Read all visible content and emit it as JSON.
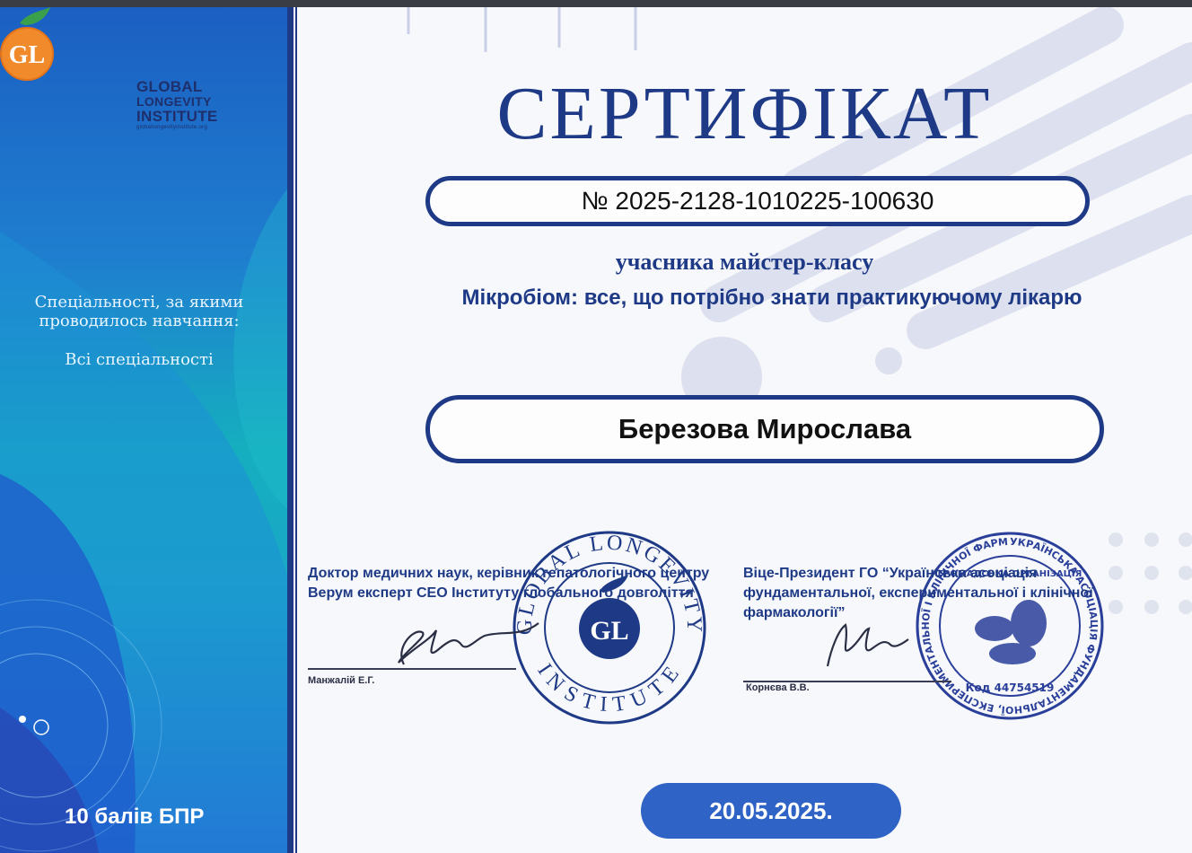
{
  "logo": {
    "line1": "GLOBAL",
    "line2": "LONGEVITY",
    "line3": "INSTITUTE",
    "url": "globallongevityinstitute.org",
    "monogram": "GL"
  },
  "sidebar": {
    "specialties_title": "Спеціальності, за якими проводилось навчання:",
    "specialties_value": "Всі спеціальності",
    "points": "10 балів БПР"
  },
  "certificate": {
    "title": "СЕРТИФІКАТ",
    "number": "№ 2025-2128-1010225-100630",
    "participant_label": "учасника майстер-класу",
    "course": "Мікробіом: все, що потрібно знати практикуючому лікарю",
    "recipient": "Березова Мирослава",
    "date": "20.05.2025."
  },
  "signatures": [
    {
      "position": "Доктор медичних наук, керівник гепатологічного центру Верум експерт CEO Інституту глобального довголіття",
      "name": "Манжалій Е.Г."
    },
    {
      "position": "Віце-Президент ГО “Українська асоціація фундаментальної, експериментальної і клінічної фармакології”",
      "name": "Корнєва В.В."
    }
  ],
  "stamps": {
    "institute_top": "GLOBAL LONGEVITY",
    "institute_bottom": "INSTITUTE",
    "association_ring": "УКРАЇНСЬКА АСОЦІАЦІЯ ФУНДАМЕНТАЛЬНОЇ, ЕКСПЕРИМЕНТАЛЬНОЇ І КЛІНІЧНОЇ ФАРМАКОЛОГІЇ",
    "association_inner": "ГРОМАДСЬКА ОРГАНІЗАЦІЯ",
    "association_code": "Код 44754519"
  },
  "colors": {
    "brand_navy": "#1e3a86",
    "date_pill": "#2f63c6",
    "logo_orange": "#f08a2a"
  }
}
